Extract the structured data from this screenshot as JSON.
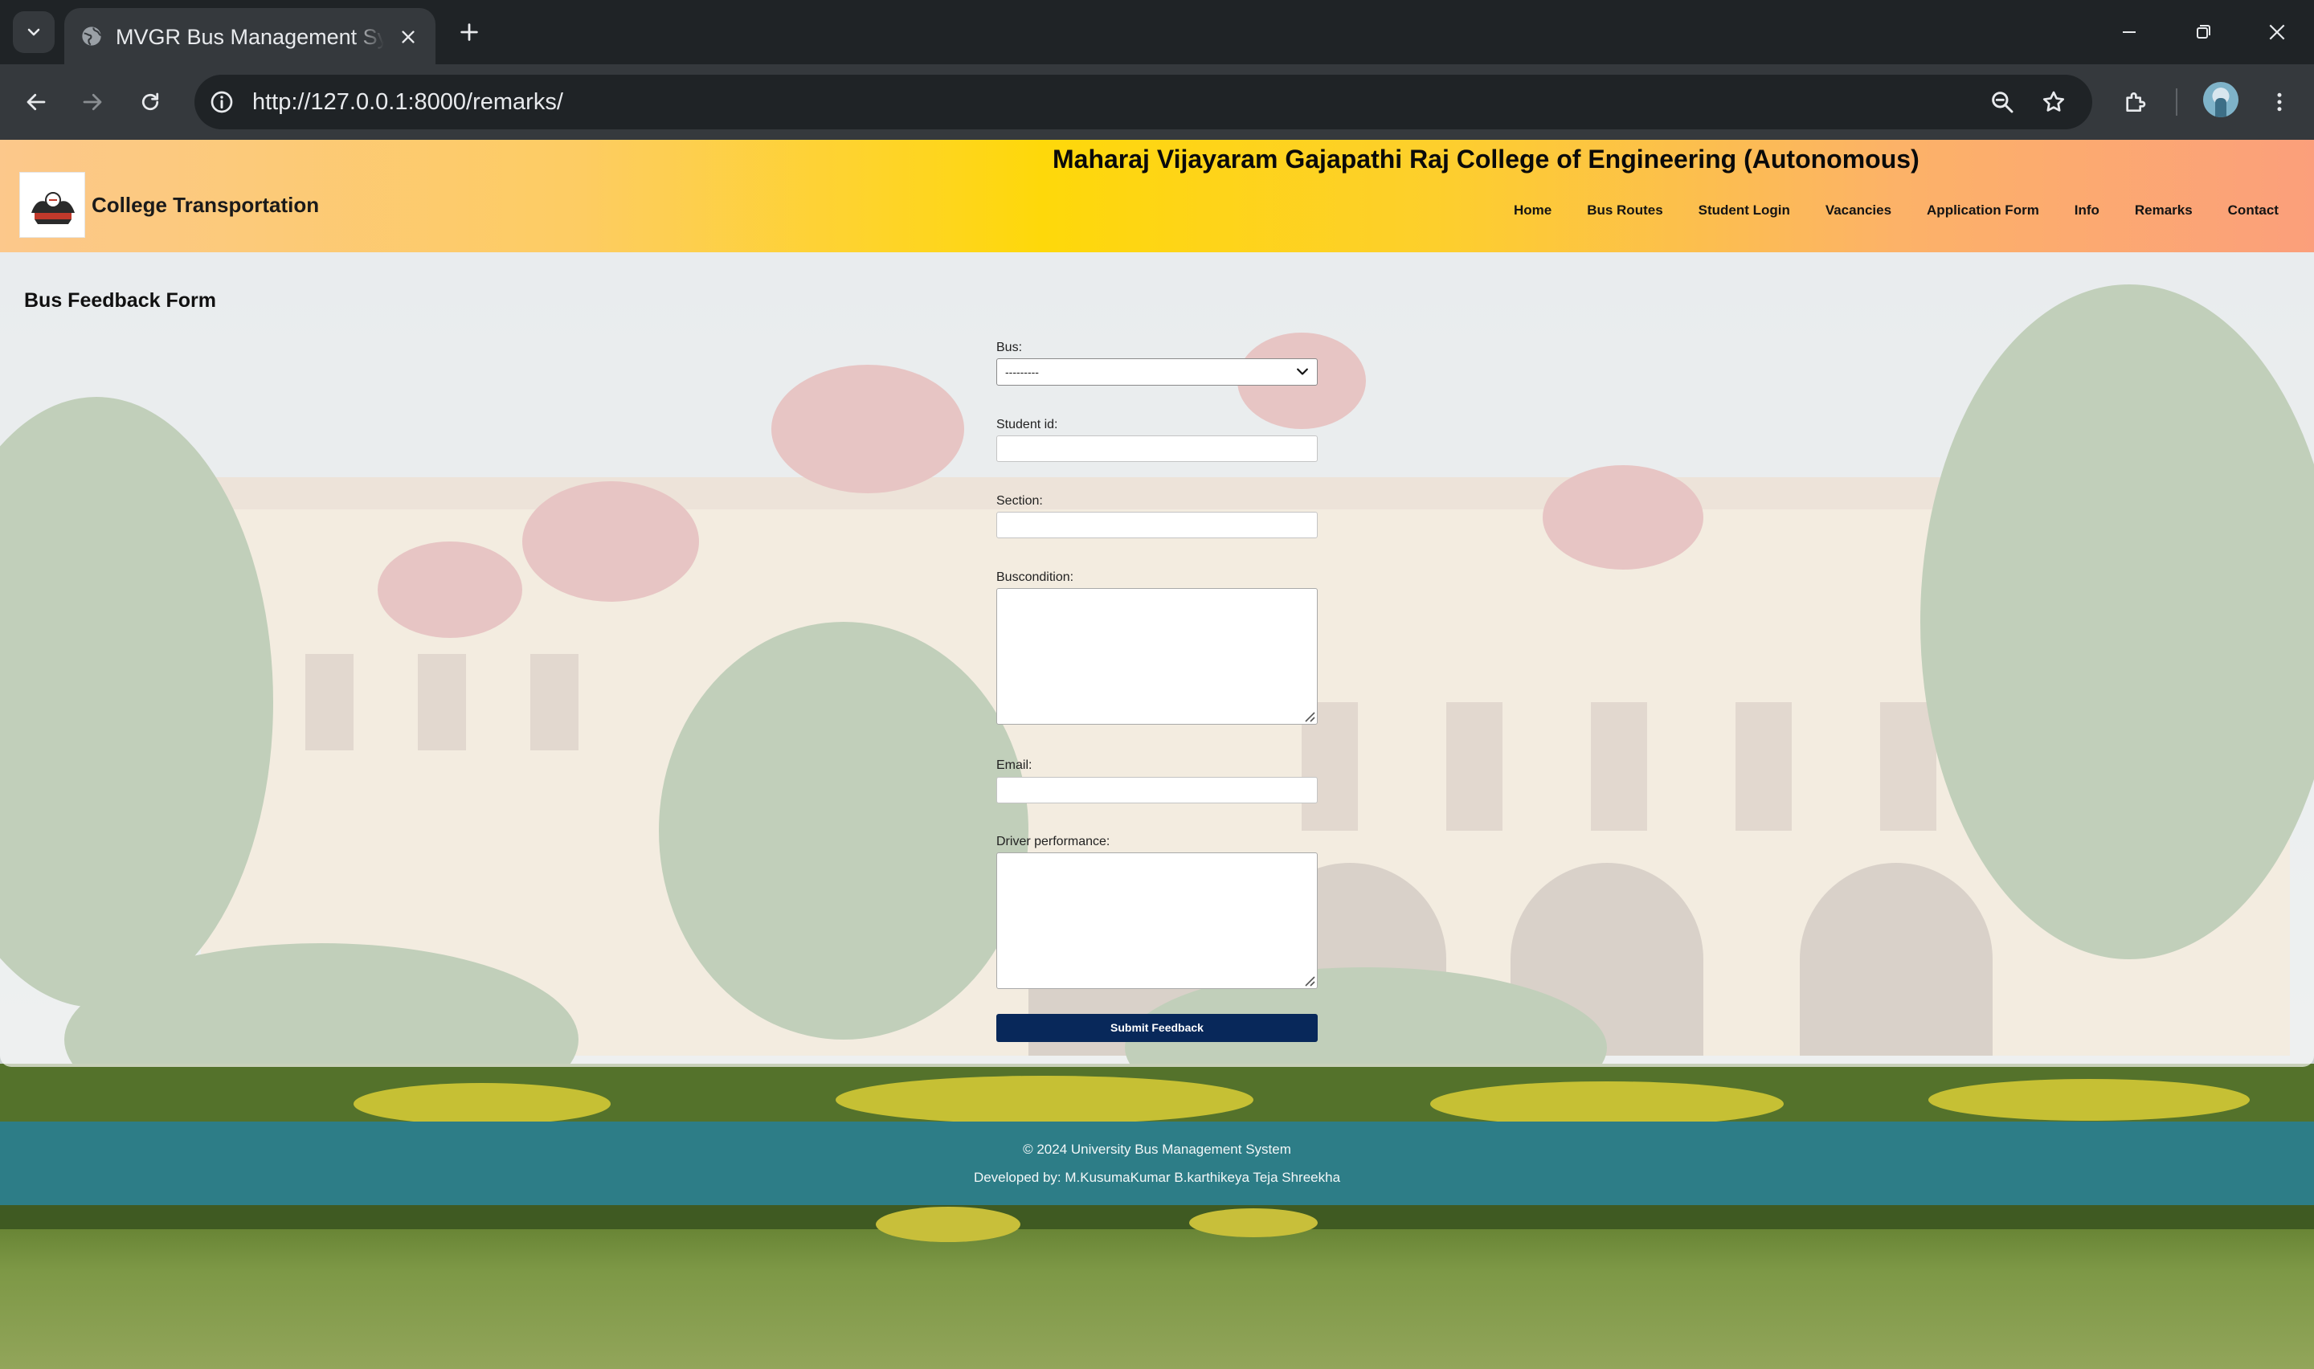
{
  "browser": {
    "tab_title": "MVGR Bus Management System",
    "url": "http://127.0.0.1:8000/remarks/"
  },
  "header": {
    "college_name": "Maharaj Vijayaram Gajapathi Raj College of Engineering (Autonomous)",
    "logo_name": "College Transportation",
    "nav": [
      "Home",
      "Bus Routes",
      "Student Login",
      "Vacancies",
      "Application Form",
      "Info",
      "Remarks",
      "Contact"
    ]
  },
  "form": {
    "title": "Bus Feedback Form",
    "bus_label": "Bus:",
    "bus_selected": "---------",
    "student_id_label": "Student id:",
    "section_label": "Section:",
    "buscondition_label": "Buscondition:",
    "email_label": "Email:",
    "driver_label": "Driver performance:",
    "submit_label": "Submit Feedback"
  },
  "footer": {
    "copyright": "© 2024 University Bus Management System",
    "developers": "Developed by: M.KusumaKumar B.karthikeya Teja Shreekha"
  },
  "colors": {
    "header_gradient_center": "#fed80a",
    "submit_button": "#08285a",
    "footer": "#2d7d87"
  }
}
